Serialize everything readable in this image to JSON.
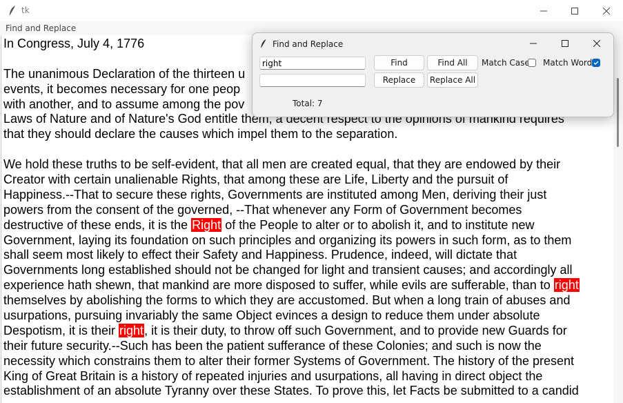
{
  "window": {
    "title": "tk"
  },
  "menu": {
    "items": [
      "Find and Replace"
    ]
  },
  "document": {
    "lines": [
      [
        {
          "t": "In Congress, July 4, 1776"
        }
      ],
      [
        {
          "t": ""
        }
      ],
      [
        {
          "t": "The unanimous Declaration of the thirteen u"
        }
      ],
      [
        {
          "t": "events, it becomes necessary for one peop"
        }
      ],
      [
        {
          "t": "with another, and to assume among the pov"
        }
      ],
      [
        {
          "t": "Laws of Nature and of Nature's God entitle them, a decent respect to the opinions of mankind requires"
        }
      ],
      [
        {
          "t": "that they should declare the causes which impel them to the separation."
        }
      ],
      [
        {
          "t": ""
        }
      ],
      [
        {
          "t": "We hold these truths to be self-evident, that all men are created equal, that they are endowed by their"
        }
      ],
      [
        {
          "t": "Creator with certain unalienable Rights, that among these are Life, Liberty and the pursuit of"
        }
      ],
      [
        {
          "t": "Happiness.--That to secure these rights, Governments are instituted among Men, deriving their just"
        }
      ],
      [
        {
          "t": "powers from the consent of the governed, --That whenever any Form of Government becomes"
        }
      ],
      [
        {
          "t": "destructive of these ends, it is the "
        },
        {
          "t": "Right",
          "hl": true
        },
        {
          "t": " of the People to alter or to abolish it, and to institute new"
        }
      ],
      [
        {
          "t": "Government, laying its foundation on such principles and organizing its powers in such form, as to them"
        }
      ],
      [
        {
          "t": "shall seem most likely to effect their Safety and Happiness. Prudence, indeed, will dictate that"
        }
      ],
      [
        {
          "t": "Governments long established should not be changed for light and transient causes; and accordingly all"
        }
      ],
      [
        {
          "t": "experience hath shewn, that mankind are more disposed to suffer, while evils are sufferable, than to "
        },
        {
          "t": "right",
          "hl": true
        }
      ],
      [
        {
          "t": "themselves by abolishing the forms to which they are accustomed. But when a long train of abuses and"
        }
      ],
      [
        {
          "t": "usurpations, pursuing invariably the same Object evinces a design to reduce them under absolute"
        }
      ],
      [
        {
          "t": "Despotism, it is their "
        },
        {
          "t": "right",
          "hl": true
        },
        {
          "t": ", it is their duty, to throw off such Government, and to provide new Guards for"
        }
      ],
      [
        {
          "t": "their future security.--Such has been the patient sufferance of these Colonies; and such is now the"
        }
      ],
      [
        {
          "t": "necessity which constrains them to alter their former Systems of Government. The history of the present"
        }
      ],
      [
        {
          "t": "King of Great Britain is a history of repeated injuries and usurpations, all having in direct object the"
        }
      ],
      [
        {
          "t": "establishment of an absolute Tyranny over these States. To prove this, let Facts be submitted to a candid"
        }
      ]
    ]
  },
  "dialog": {
    "title": "Find and Replace",
    "find_value": "right",
    "replace_value": "",
    "buttons": {
      "find": "Find",
      "find_all": "Find All",
      "replace": "Replace",
      "replace_all": "Replace All"
    },
    "match_case": {
      "label": "Match Case",
      "checked": false
    },
    "match_word": {
      "label": "Match Word",
      "checked": true
    },
    "status": "Total: 7"
  },
  "colors": {
    "highlight": "#ff0000",
    "accent": "#0067c0"
  }
}
